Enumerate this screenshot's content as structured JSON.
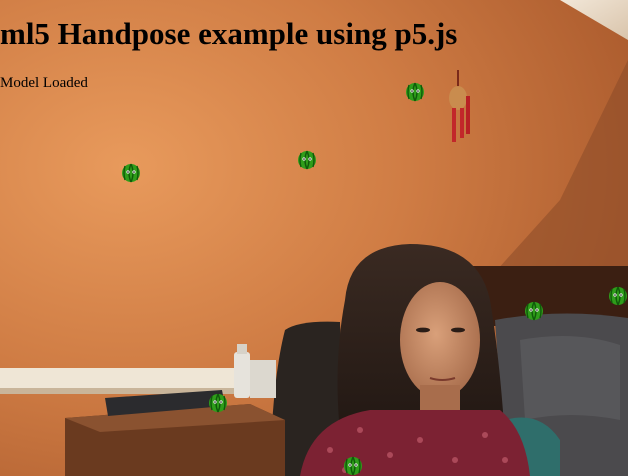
{
  "page": {
    "title": "ml5 Handpose example using p5.js",
    "status": "Model Loaded"
  },
  "canvas": {
    "description_icon": "watermelon-icon",
    "sprite_count": 8
  },
  "colors": {
    "wall": "#c9743f",
    "melon_rind": "#2f9d1a",
    "melon_stripe": "#0f5a0a"
  }
}
